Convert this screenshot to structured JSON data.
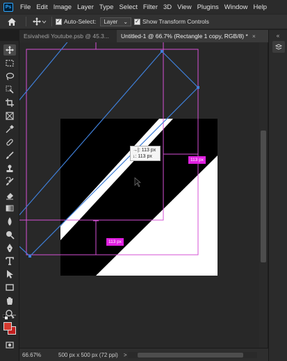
{
  "app": {
    "logo": "Ps"
  },
  "menu": [
    "File",
    "Edit",
    "Image",
    "Layer",
    "Type",
    "Select",
    "Filter",
    "3D",
    "View",
    "Plugins",
    "Window",
    "Help"
  ],
  "options": {
    "auto_select_label": "Auto-Select:",
    "auto_select_checked": true,
    "auto_select_target": "Layer",
    "transform_controls_label": "Show Transform Controls",
    "transform_controls_checked": true
  },
  "tabs": [
    {
      "label": "Esivahedi Youtube.psb @ 45.3...",
      "active": false
    },
    {
      "label": "Untitled-1 @ 66.7% (Rectangle 1 copy, RGB/8) *",
      "active": true
    }
  ],
  "canvas": {
    "tooltip_line1_icon": "→|:",
    "tooltip_line1_value": "113 px",
    "tooltip_line2_icon": "↓:",
    "tooltip_line2_value": "113 px",
    "dimension_labels": [
      "113 px",
      "113 px"
    ]
  },
  "colors": {
    "foreground": "#d63a2f",
    "background": "#c21f1f",
    "guide": "#d651d6",
    "selection_path": "#3f7fd8",
    "smart_guide_label": "#e020e0"
  },
  "status": {
    "zoom": "66.67%",
    "doc_size": "500 px x 500 px (72 ppi)",
    "arrow": ">"
  },
  "tools": [
    "move-tool-icon",
    "marquee-tool-icon",
    "lasso-tool-icon",
    "object-select-tool-icon",
    "crop-tool-icon",
    "frame-tool-icon",
    "eyedropper-tool-icon",
    "healing-brush-icon",
    "brush-tool-icon",
    "clone-stamp-icon",
    "history-brush-icon",
    "eraser-tool-icon",
    "gradient-tool-icon",
    "blur-tool-icon",
    "dodge-tool-icon",
    "pen-tool-icon",
    "type-tool-icon",
    "path-select-tool-icon",
    "rectangle-tool-icon",
    "hand-tool-icon",
    "zoom-tool-icon",
    "more-tools-icon"
  ]
}
